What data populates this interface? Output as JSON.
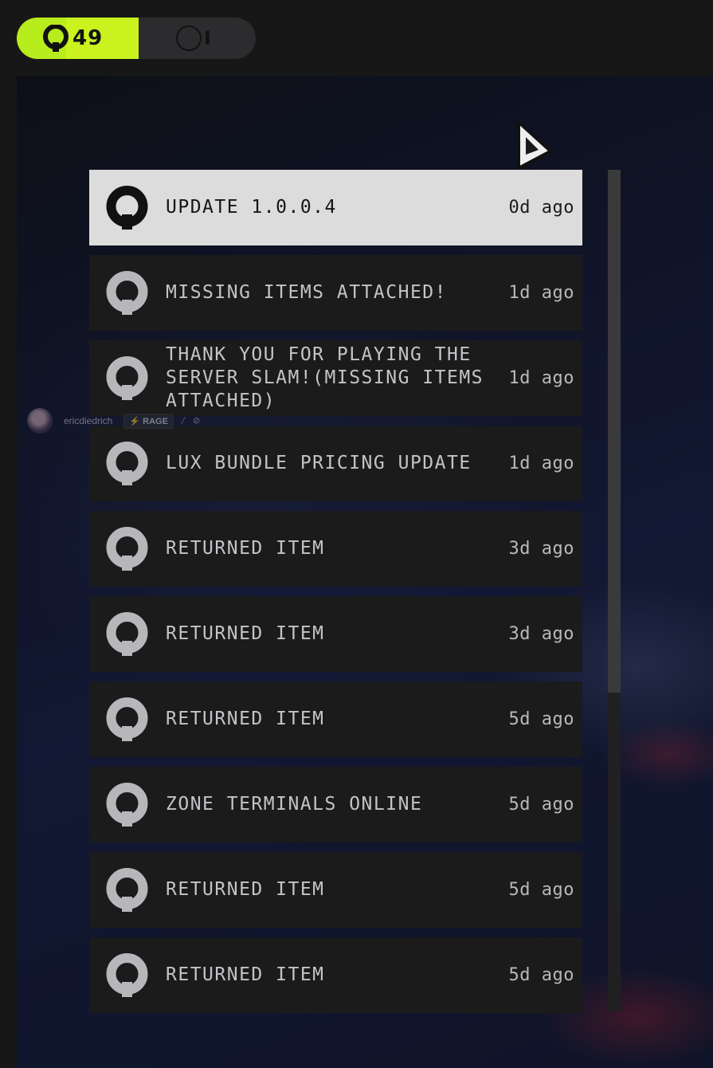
{
  "tabs": [
    {
      "icon": "ring-logo-icon",
      "count": "49",
      "active": true
    },
    {
      "icon": "circle-outline-icon",
      "label": "I",
      "active": false
    }
  ],
  "notifications": [
    {
      "title": "UPDATE 1.0.0.4",
      "time": "0d ago",
      "selected": true
    },
    {
      "title": "MISSING ITEMS ATTACHED!",
      "time": "1d ago",
      "selected": false
    },
    {
      "title": "THANK YOU FOR PLAYING THE SERVER SLAM!(MISSING ITEMS ATTACHED)",
      "time": "1d ago",
      "selected": false
    },
    {
      "title": "LUX BUNDLE PRICING UPDATE",
      "time": "1d ago",
      "selected": false
    },
    {
      "title": "RETURNED ITEM",
      "time": "3d ago",
      "selected": false
    },
    {
      "title": "RETURNED ITEM",
      "time": "3d ago",
      "selected": false
    },
    {
      "title": "RETURNED ITEM",
      "time": "5d ago",
      "selected": false
    },
    {
      "title": "ZONE TERMINALS ONLINE",
      "time": "5d ago",
      "selected": false
    },
    {
      "title": "RETURNED ITEM",
      "time": "5d ago",
      "selected": false
    },
    {
      "title": "RETURNED ITEM",
      "time": "5d ago",
      "selected": false
    }
  ],
  "overlay_user": {
    "name": "ericdiedrich",
    "badge": "RAGE"
  },
  "colors": {
    "accent": "#c9f21f",
    "row_bg": "#1b1b1c",
    "row_selected_bg": "#dcdcdc",
    "text": "#c4c4c8"
  }
}
